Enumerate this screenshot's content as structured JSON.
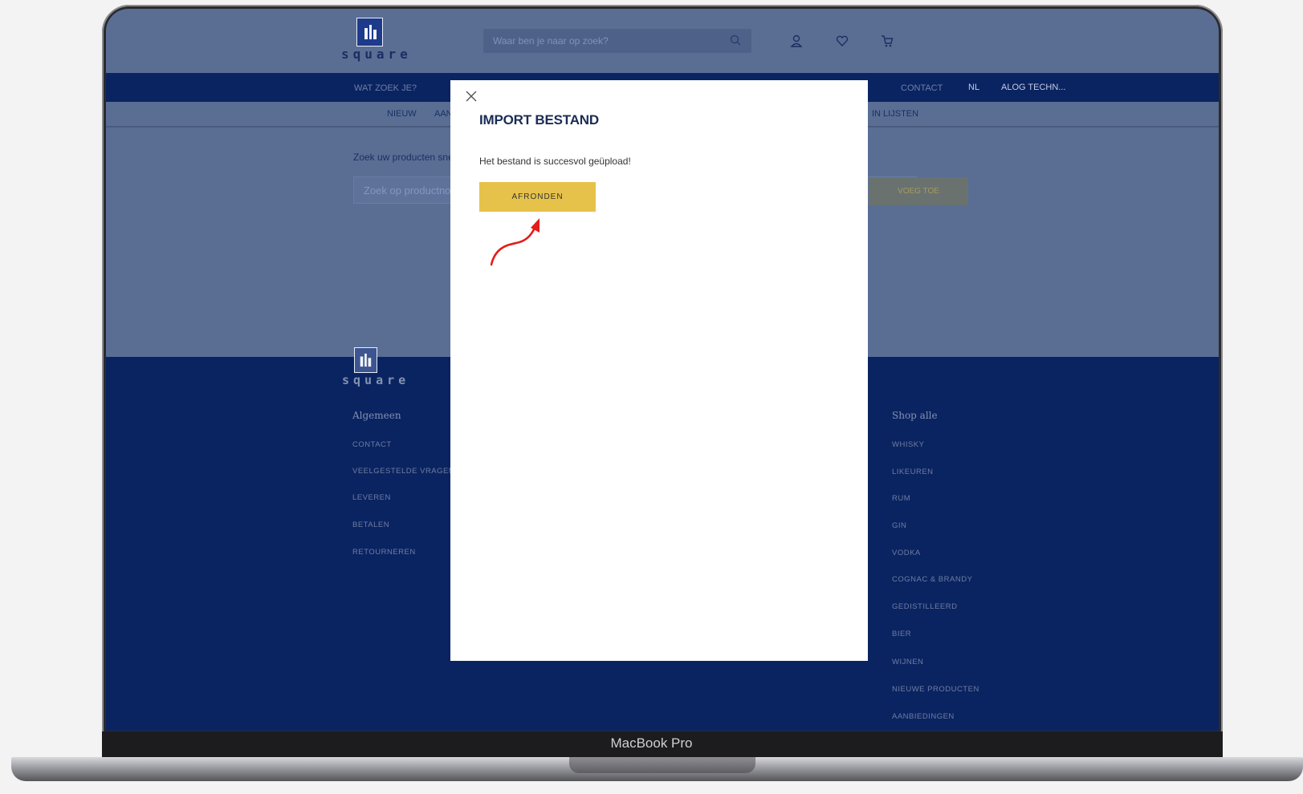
{
  "device": {
    "model_label": "MacBook Pro"
  },
  "header": {
    "logo_text": "square",
    "search_placeholder": "Waar ben je naar op zoek?"
  },
  "nav_primary": {
    "items": [
      "WAT ZOEK JE?",
      "CONTACT",
      "NL",
      "ALOG TECHN..."
    ]
  },
  "nav_secondary": {
    "items": [
      "NIEUW",
      "AAN",
      "IN LIJSTEN"
    ]
  },
  "hero": {
    "intro": "Zoek uw producten snel",
    "product_search_placeholder": "Zoek op productno",
    "add_button": "VOEG TOE"
  },
  "footer": {
    "logo_text": "square",
    "general_heading": "Algemeen",
    "general_links": [
      "CONTACT",
      "VEELGESTELDE VRAGEN",
      "LEVEREN",
      "BETALEN",
      "RETOURNEREN"
    ],
    "shop_heading": "Shop alle",
    "shop_links": [
      "WHISKY",
      "LIKEUREN",
      "RUM",
      "GIN",
      "VODKA",
      "COGNAC & BRANDY",
      "GEDISTILLEERD",
      "BIER",
      "WIJNEN",
      "NIEUWE PRODUCTEN",
      "AANBIEDINGEN"
    ]
  },
  "modal": {
    "title": "IMPORT BESTAND",
    "message": "Het bestand is succesvol geüpload!",
    "button_label": "AFRONDEN"
  },
  "colors": {
    "header_bg": "#5a6e94",
    "nav_bg": "#0a2462",
    "button_yellow": "#e7c24a",
    "annotation_red": "#e31c1c"
  },
  "icons": [
    "search-icon",
    "account-icon",
    "heart-icon",
    "cart-icon",
    "close-icon",
    "annotation-arrow-icon"
  ]
}
